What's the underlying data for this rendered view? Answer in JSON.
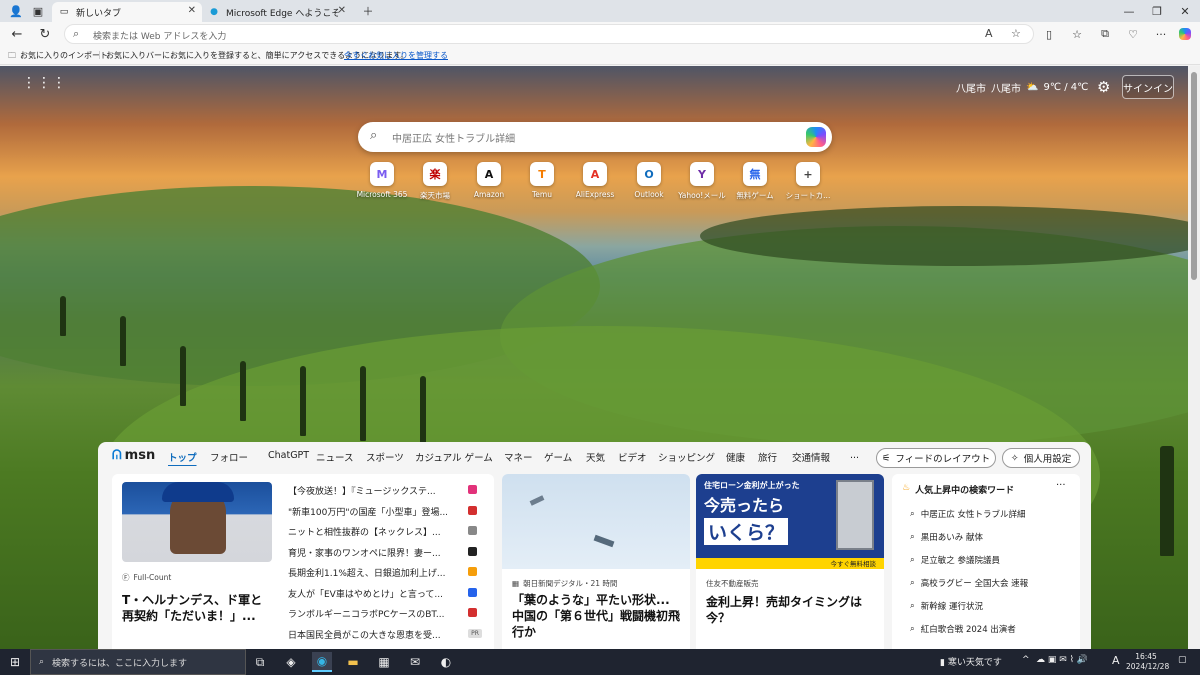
{
  "tabs": [
    {
      "label": "新しいタブ"
    },
    {
      "label": "Microsoft Edge へようこそ"
    }
  ],
  "addressbar": {
    "placeholder": "検索または Web アドレスを入力"
  },
  "favbar": {
    "import": "お気に入りのインポート",
    "message": "お気に入りバーにお気に入りを登録すると、簡単にアクセスできるようになります。",
    "link": "今すぐお気に入りを管理する"
  },
  "top": {
    "location": "八尾市",
    "city": "八尾市",
    "temp": "9℃ / 4℃",
    "signin": "サインイン"
  },
  "search": {
    "placeholder": "中居正広 女性トラブル詳細"
  },
  "quicklinks": [
    {
      "label": "Microsoft 365",
      "icon": "microsoft-365-icon",
      "color": "#7a5cf0"
    },
    {
      "label": "楽天市場",
      "icon": "rakuten-icon",
      "color": "#bf0000"
    },
    {
      "label": "Amazon",
      "icon": "amazon-icon",
      "color": "#111111"
    },
    {
      "label": "Temu",
      "icon": "temu-icon",
      "color": "#f57c00"
    },
    {
      "label": "AliExpress",
      "icon": "aliexpress-icon",
      "color": "#e43225"
    },
    {
      "label": "Outlook",
      "icon": "outlook-icon",
      "color": "#0f6cbd"
    },
    {
      "label": "Yahoo!メール",
      "icon": "yahoo-mail-icon",
      "color": "#6f2da8"
    },
    {
      "label": "無料ゲーム",
      "icon": "games-icon",
      "color": "#2563eb"
    },
    {
      "label": "ショートカ...",
      "icon": "plus-icon",
      "color": "#444444"
    }
  ],
  "feed": {
    "brand": "msn",
    "tabs": [
      "トップ",
      "フォロー",
      "ChatGPT",
      "ニュース",
      "スポーツ",
      "カジュアル ゲーム",
      "マネー",
      "ゲーム",
      "天気",
      "ビデオ",
      "ショッピング",
      "健康",
      "旅行",
      "交通情報",
      "..."
    ],
    "layout_button": "フィードのレイアウト",
    "personal_button": "個人用設定",
    "main_source": "Full-Count",
    "main_headline": "T・ヘルナンデス、ド軍と再契約「ただいま！」...",
    "news": [
      {
        "text": "【今夜放送！】『ミュージックステ...",
        "color": "#e2327a"
      },
      {
        "text": "\"新車100万円\"の国産「小型車」登場...",
        "color": "#d32f2f"
      },
      {
        "text": "ニットと相性抜群の【ネックレス】...",
        "color": "#888888"
      },
      {
        "text": "育児・家事のワンオペに限界！妻ー...",
        "color": "#222222"
      },
      {
        "text": "長期金利1.1%超え、日銀追加利上げ...",
        "color": "#f59e0b"
      },
      {
        "text": "友人が「EV車はやめとけ」と言って...",
        "color": "#2563eb"
      },
      {
        "text": "ランボルギーニコラボPCケースのBT...",
        "color": "#d32f2f"
      },
      {
        "text": "日本国民全員がこの大きな恩恵を受...",
        "badge": "PR",
        "color": "#dddddd"
      }
    ],
    "card2_source": "朝日新聞デジタル・21 時間",
    "card2_headline": "「葉のような」平たい形状... 中国の「第６世代」戦闘機初飛行か",
    "ad_text1": "住宅ローン金利が上がった",
    "ad_text2": "今売ったら",
    "ad_text3": "いくら？",
    "ad_cta": "今すぐ無料相談",
    "card3_source": "住友不動産販売",
    "card3_headline": "金利上昇！売却タイミングは今？",
    "trend_title": "人気上昇中の検索ワード",
    "trends": [
      "中居正広 女性トラブル詳細",
      "黒田あいみ 献体",
      "足立敏之 参議院議員",
      "高校ラグビー 全国大会 速報",
      "新幹線 運行状況",
      "紅白歌合戦 2024 出演者"
    ]
  },
  "taskbar": {
    "search": "検索するには、ここに入力します",
    "weather": "寒い天気です",
    "ime": "A",
    "time": "16:45",
    "date": "2024/12/28"
  }
}
